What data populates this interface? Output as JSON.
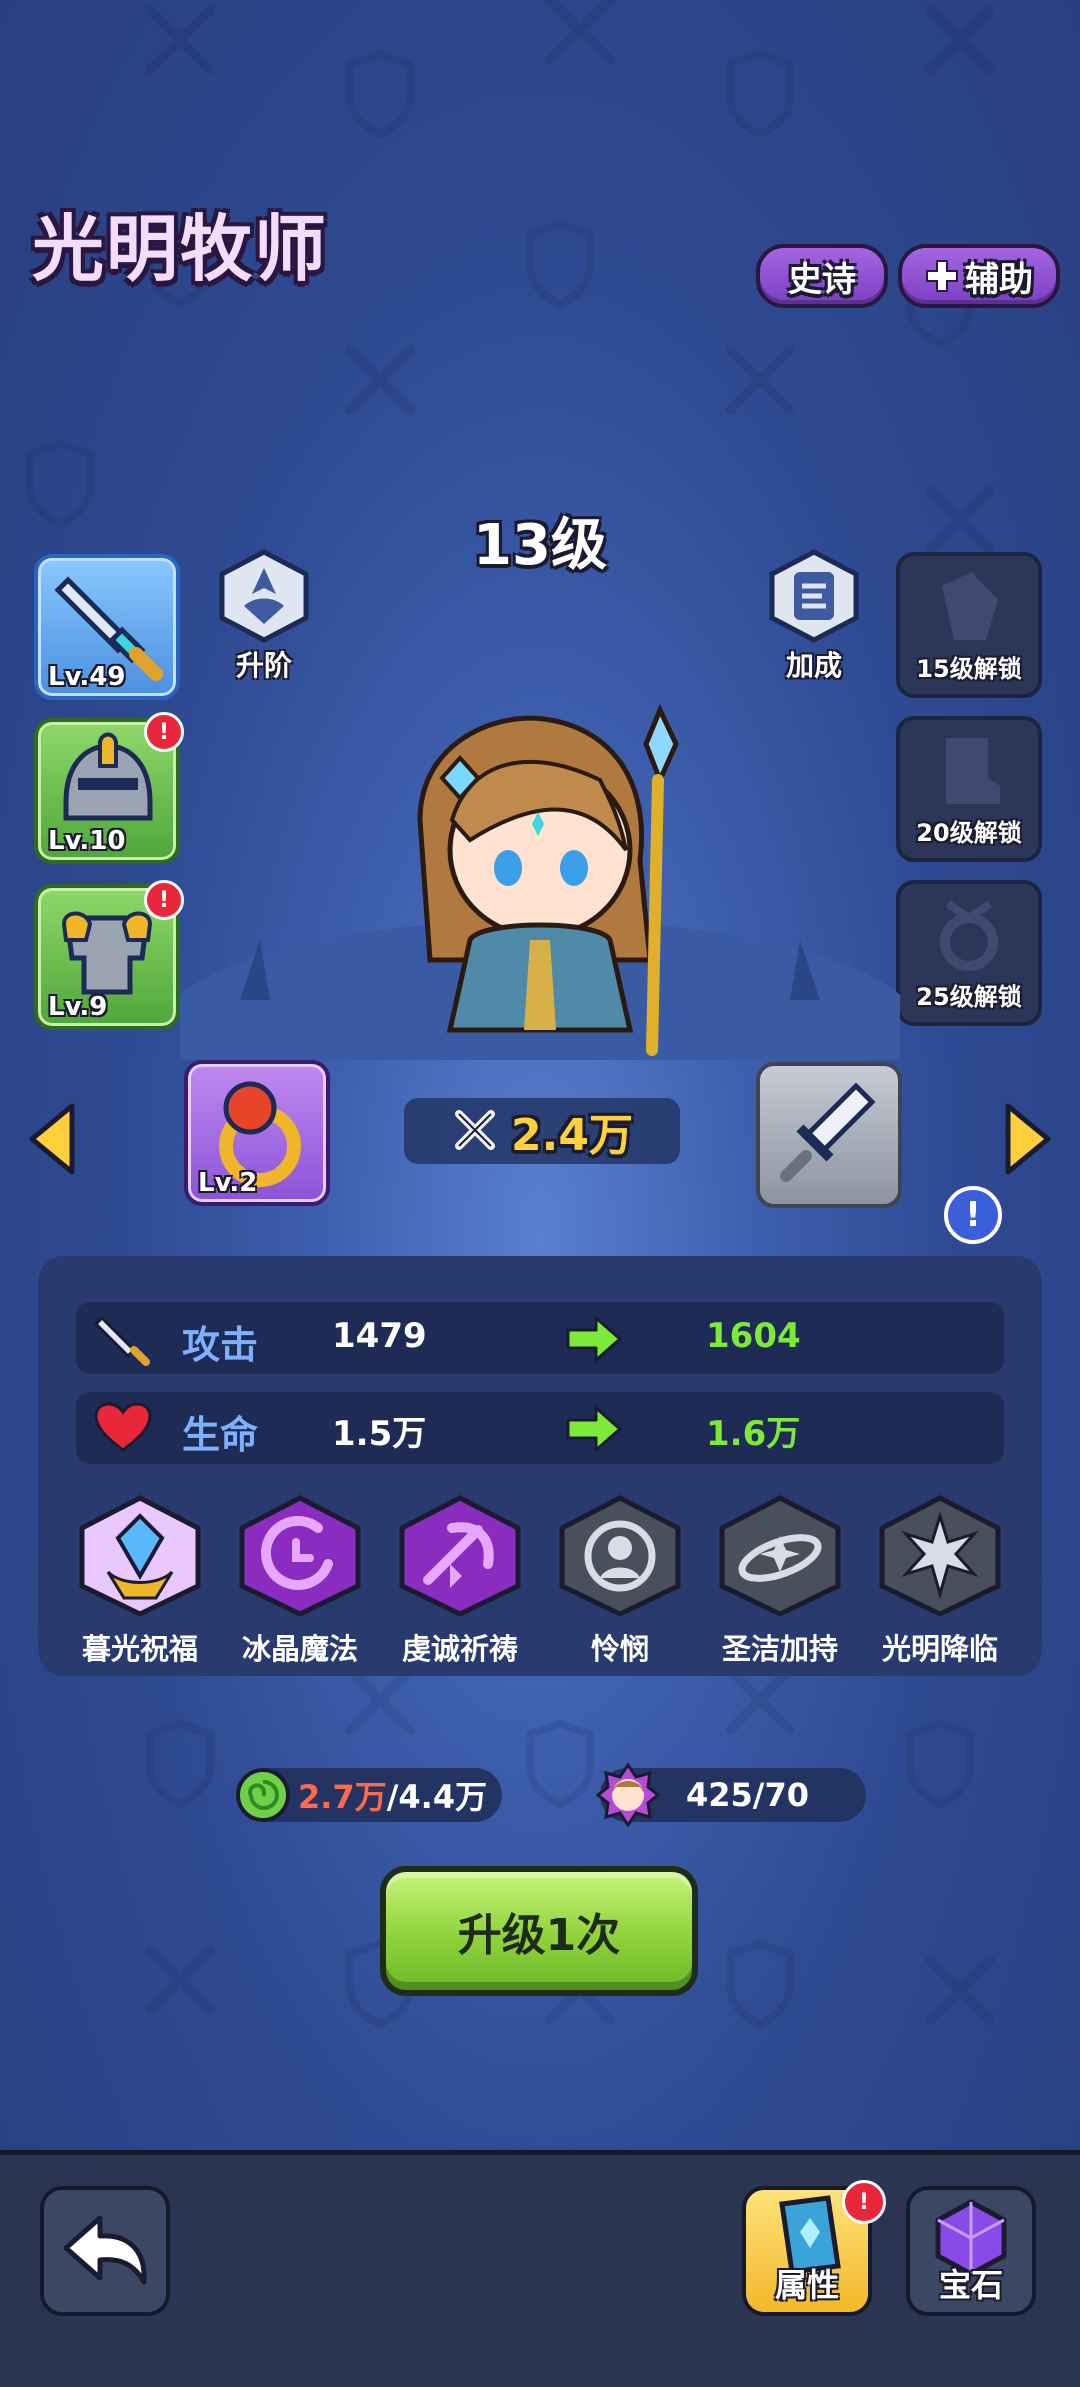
{
  "hero": {
    "name": "光明牧师",
    "rarity_tag": "史诗",
    "role_tag": "辅助",
    "level_text": "13级",
    "power": "2.4万"
  },
  "side_buttons": {
    "upgrade_rank": "升阶",
    "bonus": "加成"
  },
  "equipment_left": [
    {
      "name": "sword",
      "level": "Lv.49",
      "has_alert": false
    },
    {
      "name": "helmet",
      "level": "Lv.10",
      "has_alert": true
    },
    {
      "name": "armor",
      "level": "Lv.9",
      "has_alert": true
    }
  ],
  "equipment_right_locked": [
    {
      "name": "gloves",
      "unlock_text": "15级解锁"
    },
    {
      "name": "boots",
      "unlock_text": "20级解锁"
    },
    {
      "name": "amulet",
      "unlock_text": "25级解锁"
    }
  ],
  "ring": {
    "level": "Lv.2"
  },
  "alerts": {
    "badge_symbol": "!"
  },
  "stats": [
    {
      "name": "攻击",
      "current": "1479",
      "next": "1604",
      "icon": "sword-icon"
    },
    {
      "name": "生命",
      "current": "1.5万",
      "next": "1.6万",
      "icon": "heart-icon"
    }
  ],
  "skills": [
    {
      "name": "暮光祝福",
      "color": "#e9c8ff"
    },
    {
      "name": "冰晶魔法",
      "color": "#8a2cc0"
    },
    {
      "name": "虔诚祈祷",
      "color": "#8a2cc0"
    },
    {
      "name": "怜悯",
      "color": "#4a4f5c"
    },
    {
      "name": "圣洁加持",
      "color": "#4a4f5c"
    },
    {
      "name": "光明降临",
      "color": "#4a4f5c"
    }
  ],
  "resources": {
    "exp_current": "2.7万",
    "exp_total": "/4.4万",
    "shards": "425/70"
  },
  "upgrade_button": "升级1次",
  "bottom": {
    "attributes": "属性",
    "gems": "宝石"
  }
}
